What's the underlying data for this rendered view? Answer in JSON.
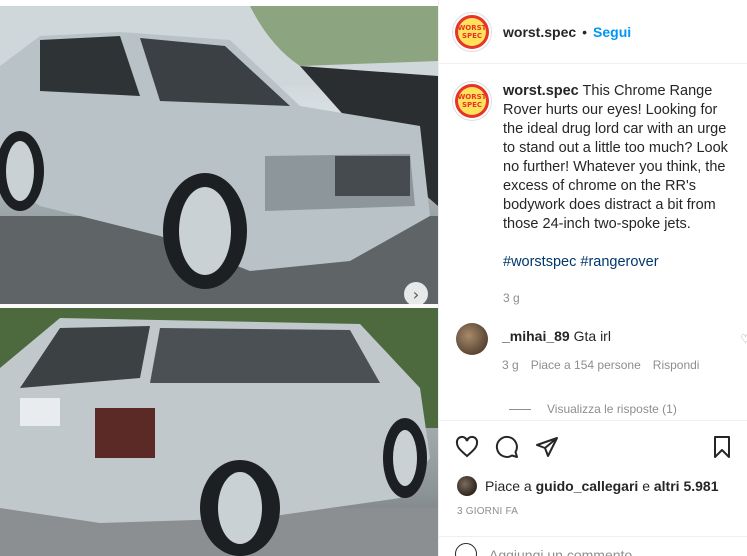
{
  "post": {
    "username": "worst.spec",
    "follow_label": "Segui",
    "separator": "•",
    "avatar_text_line1": "WORST",
    "avatar_text_line2": "SPEC",
    "caption_username": "worst.spec",
    "caption_text": "This Chrome Range Rover hurts our eyes! Looking for the ideal drug lord car with an urge to stand out a little too much? Look no further! Whatever you think, the excess of chrome on the RR's bodywork does distract a bit from those 24-inch two-spoke jets.",
    "hashtag_1": "#worstspec",
    "hashtag_2": "#rangerover",
    "caption_time": "3 g"
  },
  "comment": {
    "username": "_mihai_89",
    "text": "Gta irl",
    "time": "3 g",
    "likes": "Piace a 154 persone",
    "reply_label": "Rispondi",
    "view_replies": "Visualizza le risposte (1)"
  },
  "likes_line": {
    "prefix": "Piace a",
    "user": "guido_callegari",
    "suffix": "e",
    "others": "altri 5.981"
  },
  "date": "3 GIORNI FA",
  "add_comment_placeholder": "Aggiungi un commento...",
  "icons": {
    "next": "chevron-right-icon",
    "like": "heart-icon",
    "comment": "comment-icon",
    "share": "paper-plane-icon",
    "save": "bookmark-icon"
  },
  "colors": {
    "link_blue": "#0095f6",
    "hashtag": "#00376b",
    "avatar_red": "#e8332a",
    "avatar_yellow": "#fde25a"
  }
}
